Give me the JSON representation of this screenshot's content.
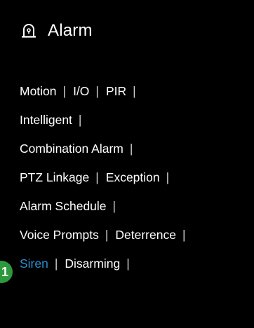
{
  "header": {
    "title": "Alarm",
    "icon": "alarm-bell-icon"
  },
  "rows": [
    [
      {
        "label": "Motion"
      },
      {
        "label": "I/O"
      },
      {
        "label": "PIR"
      }
    ],
    [
      {
        "label": "Intelligent"
      }
    ],
    [
      {
        "label": "Combination Alarm"
      }
    ],
    [
      {
        "label": "PTZ Linkage"
      },
      {
        "label": "Exception"
      }
    ],
    [
      {
        "label": "Alarm Schedule"
      }
    ],
    [
      {
        "label": "Voice Prompts"
      },
      {
        "label": "Deterrence"
      }
    ],
    [
      {
        "label": "Siren",
        "active": true
      },
      {
        "label": "Disarming"
      }
    ]
  ],
  "separator": "|",
  "badge": {
    "number": "1"
  },
  "colors": {
    "background": "#000000",
    "text": "#ffffff",
    "active": "#2e8fd0",
    "badge": "#2c9a3c"
  }
}
